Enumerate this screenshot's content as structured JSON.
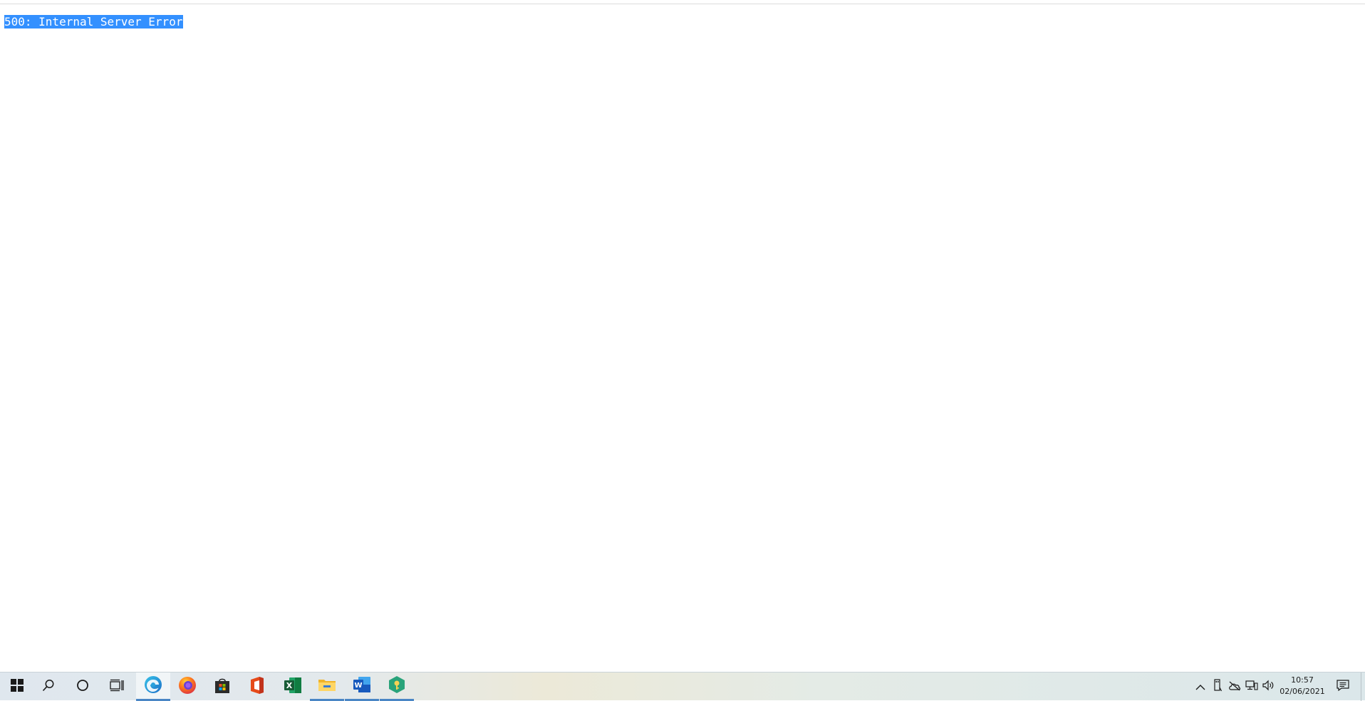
{
  "page": {
    "error_message": "500: Internal Server Error"
  },
  "taskbar": {
    "start": "windows-start-icon",
    "search": "search-icon",
    "cortana": "cortana-icon",
    "task_view": "task-view-icon",
    "pinned_apps": [
      "edge",
      "firefox",
      "microsoft-store",
      "office",
      "excel",
      "file-explorer",
      "word",
      "keepass"
    ],
    "tray": {
      "show_hidden": "chevron-up-icon",
      "icons": [
        "usb-device-icon",
        "onedrive-offline-icon",
        "network-icon",
        "volume-icon"
      ]
    },
    "clock": {
      "time": "10:57",
      "date": "02/06/2021"
    },
    "notifications": "notification-center-icon"
  },
  "colors": {
    "selection": "#3390ff",
    "taskbar_active_indicator": "#4a86c5"
  }
}
